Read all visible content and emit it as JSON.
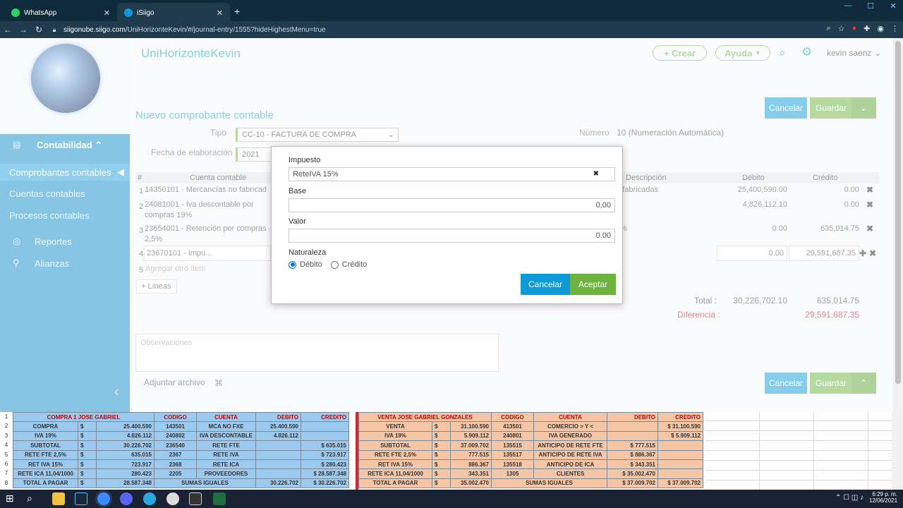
{
  "browser": {
    "tabs": [
      {
        "title": "WhatsApp",
        "close": "✕"
      },
      {
        "title": "iSiigo",
        "close": "✕"
      }
    ],
    "new_tab": "+",
    "url_host": "siigonube.siigo.com",
    "url_path": "/UniHorizonteKevin/#/journal-entry/1555?hideHighestMenu=true"
  },
  "sidebar": {
    "section": "Contabilidad",
    "items": [
      "Comprobantes contables",
      "Cuentas contables",
      "Procesos contables"
    ],
    "reportes": "Reportes",
    "alianzas": "Alianzas",
    "collapse": "‹"
  },
  "header": {
    "company": "UniHorizonteKevin",
    "crear": "+ Crear",
    "ayuda": "Ayuda",
    "user": "kevin saenz"
  },
  "form": {
    "title": "Nuevo comprobante contable",
    "tipo_label": "Tipo",
    "tipo_value": "CC-10 - FACTURA DE COMPRA",
    "fecha_label": "Fecha de elaboración",
    "fecha_value": "2021",
    "numero_label": "Número",
    "numero_value": "10 (Numeración Automática)",
    "cancelar": "Cancelar",
    "guardar": "Guardar"
  },
  "table": {
    "headers": {
      "num": "#",
      "cuenta": "Cuenta contable",
      "descripcion": "Descripción",
      "debito": "Débito",
      "credito": "Crédito"
    },
    "rows": [
      {
        "n": "1",
        "cuenta": "14350101 - Mercancías no fabricad",
        "desc": "o fabricadas",
        "debito": "25,400,590.00",
        "credito": "0.00"
      },
      {
        "n": "2",
        "cuenta": "24081001 - Iva descontable por",
        "cuenta2": "compras 19%",
        "desc": "",
        "debito": "4,826,112.10",
        "credito": "0.00"
      },
      {
        "n": "3",
        "cuenta": "23654001 - Retención por compras",
        "cuenta2": "2,5%",
        "desc": "5%",
        "debito": "0.00",
        "credito": "635,014.75"
      },
      {
        "n": "4",
        "cuenta": "23670101 - Impu...",
        "desc": "",
        "debito": "0.00",
        "credito": "29,591,687.35"
      }
    ],
    "row5_num": "5",
    "add_item": "Agregar otro ítem",
    "lineas": "+ Líneas",
    "total_label": "Total :",
    "total_debito": "30,226,702.10",
    "total_credito": "635,014.75",
    "diferencia_label": "Diferencia :",
    "diferencia_value": "29,591,687.35",
    "observaciones": "Observaciones",
    "adjuntar": "Adjuntar archivo"
  },
  "modal": {
    "impuesto_label": "Impuesto",
    "impuesto_value": "ReteIVA 15%",
    "clear": "✖",
    "base_label": "Base",
    "base_value": "0,00",
    "valor_label": "Valor",
    "valor_value": "0.00",
    "naturaleza_label": "Naturaleza",
    "debito": "Débito",
    "credito": "Crédito",
    "selected": "Débito",
    "cancelar": "Cancelar",
    "aceptar": "Aceptar"
  },
  "sheet": {
    "left": [
      [
        "COMPRA 1 JOSE GABRIEL",
        "",
        "",
        "CODIGO",
        "CUENTA",
        "DEBITO",
        "CREDITO"
      ],
      [
        "COMPRA",
        "$",
        "25.400.590",
        "143501",
        "MCA NO FXE",
        "25.400.590",
        ""
      ],
      [
        "IVA 19%",
        "$",
        "4.826.112",
        "240802",
        "IVA DESCONTABLE",
        "4.826.112",
        ""
      ],
      [
        "SUBTOTAL",
        "$",
        "30.226.702",
        "236540",
        "RETE FTE",
        "",
        "$ 635.015"
      ],
      [
        "RETE FTE 2,5%",
        "$",
        "635.015",
        "2367",
        "RETE IVA",
        "",
        "$ 723.917"
      ],
      [
        "RET IVA 15%",
        "$",
        "723.917",
        "2368",
        "RETE ICA",
        "",
        "$ 280.423"
      ],
      [
        "RETE ICA 11,04/1000",
        "$",
        "280.423",
        "2205",
        "PROVEEDORES",
        "",
        "$ 28.587.348"
      ],
      [
        "TOTAL A PAGAR",
        "$",
        "28.587.348",
        "SUMAS IGUALES",
        "",
        "30.226.702",
        "$ 30.226.702"
      ]
    ],
    "right": [
      [
        "VENTA JOSE GABRIEL GONZALES",
        "",
        "",
        "CODIGO",
        "CUENTA",
        "DEBITO",
        "CREDITO"
      ],
      [
        "VENTA",
        "$",
        "31.100.590",
        "413501",
        "COMERCIO > Y <",
        "",
        "$ 31.100.590"
      ],
      [
        "IVA 19%",
        "$",
        "5.909.112",
        "240801",
        "IVA GENERADO",
        "",
        "$ 5.909.112"
      ],
      [
        "SUBTOTAL",
        "$",
        "37.009.702",
        "135515",
        "ANTICIPO DE RETE FTE",
        "$ 777.515",
        ""
      ],
      [
        "RETE FTE 2,5%",
        "$",
        "777.515",
        "135517",
        "ANTICIPO DE RETE IVA",
        "$ 886.367",
        ""
      ],
      [
        "RET IVA 15%",
        "$",
        "886.367",
        "135518",
        "ANTICIPO DE ICA",
        "$ 343.351",
        ""
      ],
      [
        "RETE ICA 11,04/1000",
        "$",
        "343.351",
        "1305",
        "CLIENTES",
        "$ 35.002.470",
        ""
      ],
      [
        "TOTAL A PAGAR",
        "$",
        "35.002.470",
        "SUMAS IGUALES",
        "",
        "$ 37.009.702",
        "$ 37.009.702"
      ]
    ]
  },
  "taskbar": {
    "time": "6:29 p. m.",
    "date": "12/06/2021"
  },
  "colors": {
    "primary": "#0d9ad8",
    "success": "#6cb33e",
    "sidebar": "#0d8bc9",
    "danger": "#d0021b"
  }
}
